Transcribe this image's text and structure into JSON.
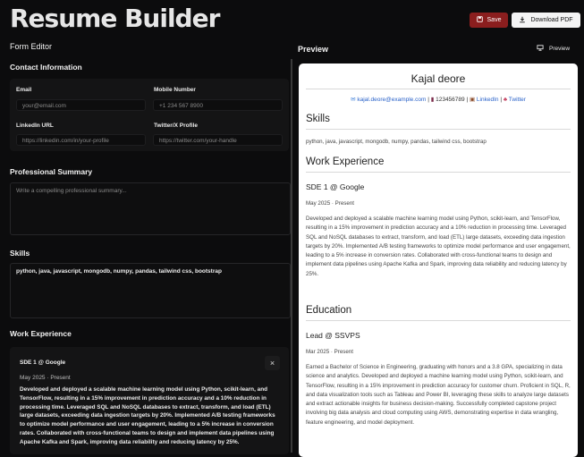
{
  "app": {
    "title": "Resume Builder"
  },
  "toolbar": {
    "save_label": "Save",
    "download_label": "Download PDF",
    "preview_label": "Preview"
  },
  "form": {
    "heading": "Form Editor",
    "contact": {
      "heading": "Contact Information",
      "email_label": "Email",
      "email_placeholder": "your@email.com",
      "mobile_label": "Mobile Number",
      "mobile_placeholder": "+1 234 567 8900",
      "linkedin_label": "LinkedIn URL",
      "linkedin_placeholder": "https://linkedin.com/in/your-profile",
      "twitter_label": "Twitter/X Profile",
      "twitter_placeholder": "https://twitter.com/your-handle"
    },
    "summary": {
      "heading": "Professional Summary",
      "placeholder": "Write a compelling professional summary..."
    },
    "skills": {
      "heading": "Skills",
      "value": "python, java, javascript, mongodb, numpy, pandas, tailwind css, bootstrap"
    },
    "work": {
      "heading": "Work Experience",
      "entry_title": "SDE 1 @ Google",
      "entry_dates": "May 2025 · Present",
      "entry_description": "Developed and deployed a scalable machine learning model using Python, scikit-learn, and TensorFlow, resulting in a 15% improvement in prediction accuracy and a 10% reduction in processing time.  Leveraged SQL and NoSQL databases to extract, transform, and load (ETL) large datasets, exceeding data ingestion targets by 20%.  Implemented A/B testing frameworks to optimize model performance and user engagement, leading to a 5% increase in conversion rates.  Collaborated with cross-functional teams to design and implement data pipelines using Apache Kafka and Spark, improving data reliability and reducing latency by 25%."
    }
  },
  "preview": {
    "heading": "Preview",
    "name": "Kajal deore",
    "email": "kajal.deore@example.com",
    "phone": "123456789",
    "linkedin": "LinkedIn",
    "twitter": "Twitter",
    "skills_heading": "Skills",
    "skills": "python, java, javascript, mongodb, numpy, pandas, tailwind css, bootstrap",
    "work_heading": "Work Experience",
    "job_title": "SDE 1 @ Google",
    "job_dates": "May 2025 · Present",
    "job_description": "Developed and deployed a scalable machine learning model using Python, scikit-learn, and TensorFlow, resulting in a 15% improvement in prediction accuracy and a 10% reduction in processing time. Leveraged SQL and NoSQL databases to extract, transform, and load (ETL) large datasets, exceeding data ingestion targets by 20%. Implemented A/B testing frameworks to optimize model performance and user engagement, leading to a 5% increase in conversion rates. Collaborated with cross-functional teams to design and implement data pipelines using Apache Kafka and Spark, improving data reliability and reducing latency by 25%.",
    "education_heading": "Education",
    "edu_title": "Lead @ SSVPS",
    "edu_dates": "Mar 2025 · Present",
    "edu_description": "Earned a Bachelor of Science in Engineering, graduating with honors and a 3.8 GPA, specializing in data science and analytics. Developed and deployed a machine learning model using Python, scikit-learn, and TensorFlow, resulting in a 15% improvement in prediction accuracy for customer churn. Proficient in SQL, R, and data visualization tools such as Tableau and Power BI, leveraging these skills to analyze large datasets and extract actionable insights for business decision-making. Successfully completed capstone project involving big data analysis and cloud computing using AWS, demonstrating expertise in data wrangling, feature engineering, and model deployment."
  },
  "colors": {
    "accent": "#8b1e1e",
    "link": "#2b63c9",
    "background": "#0c0c0d"
  }
}
